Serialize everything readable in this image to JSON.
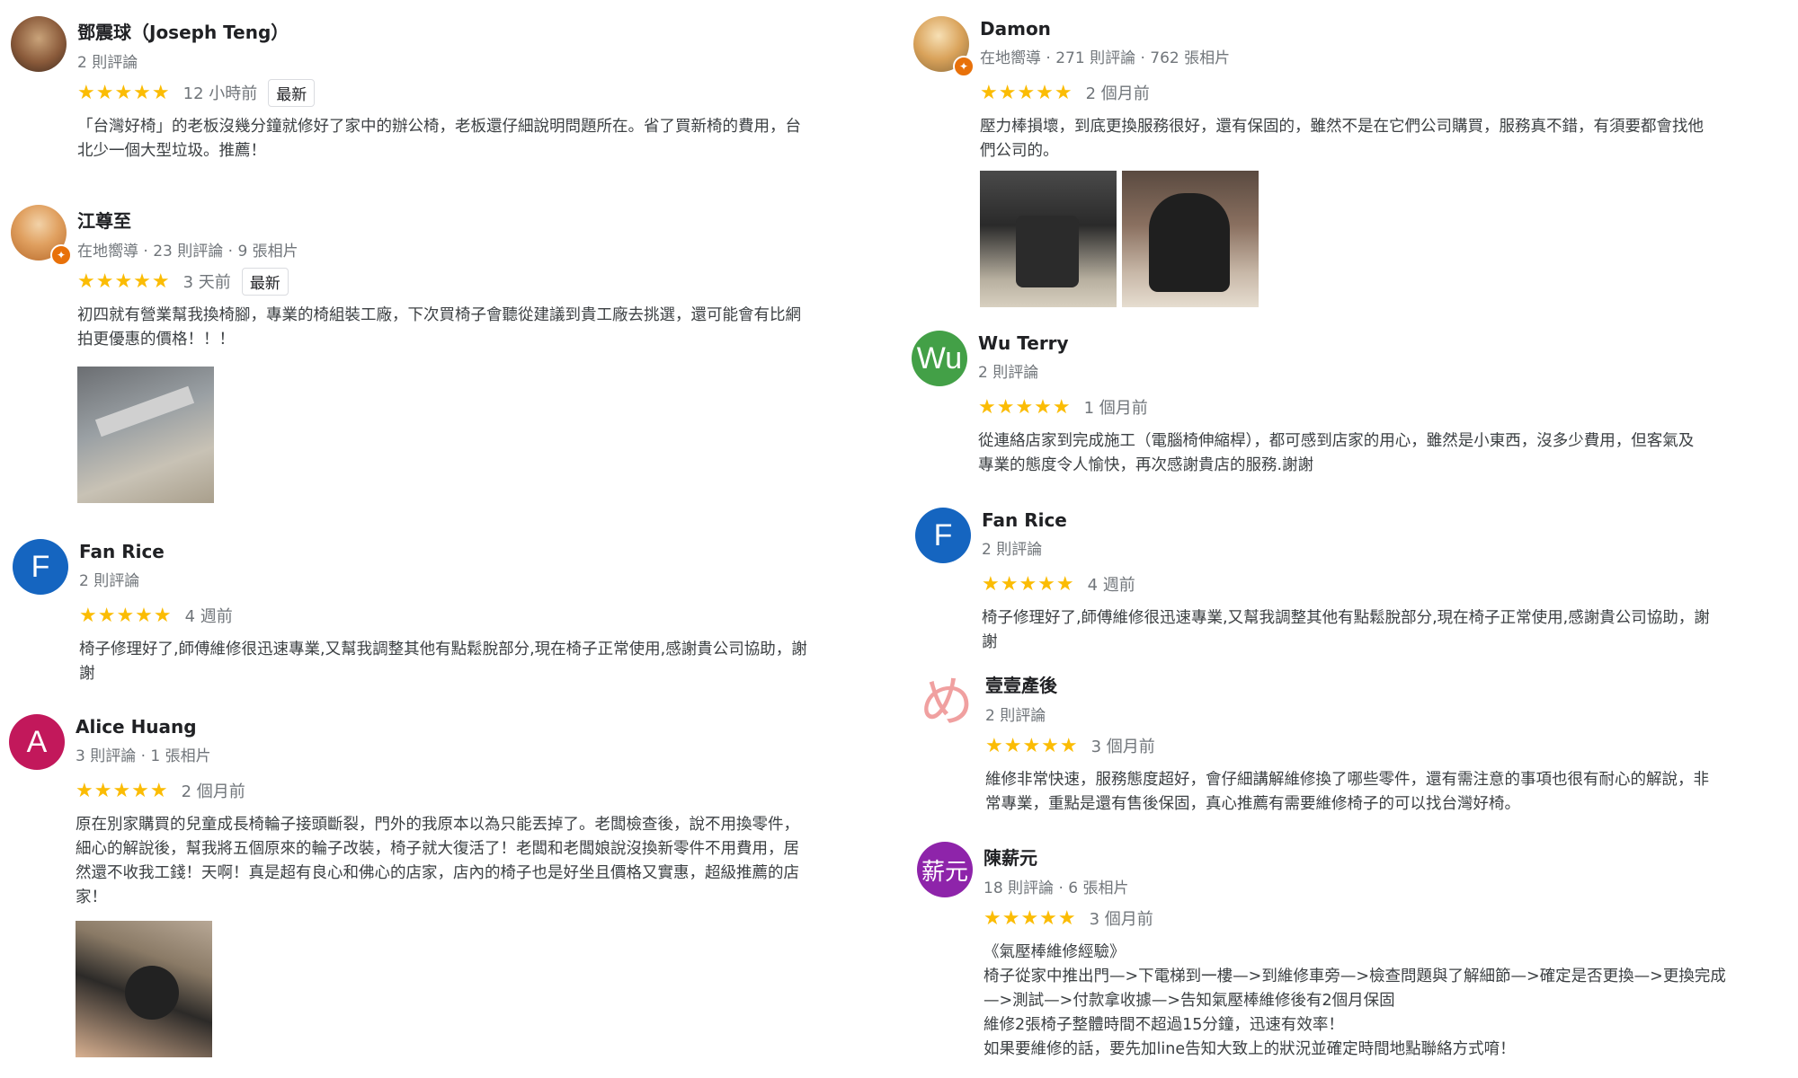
{
  "colors": {
    "star": "#fbbc04",
    "meta": "#70757a",
    "avatar_blue": "#1565c0",
    "avatar_pink": "#c2185b",
    "avatar_green": "#43a047",
    "avatar_purple": "#8e24aa"
  },
  "reviews": [
    {
      "name": "鄧震球（Joseph Teng）",
      "meta": "2 則評論",
      "stars": "★★★★★",
      "time": "12 小時前",
      "badge": "最新",
      "lines": [
        "「台灣好椅」的老板沒幾分鐘就修好了家中的辦公椅，老板還仔細說明問題所在。省了買新椅的費用，台",
        "北少一個大型垃圾。推薦！"
      ]
    },
    {
      "name": "江尊至",
      "meta": "在地嚮導 · 23 則評論 · 9 張相片",
      "stars": "★★★★★",
      "time": "3 天前",
      "badge": "最新",
      "lines": [
        "初四就有營業幫我換椅腳，專業的椅組裝工廠，下次買椅子會聽從建議到貴工廠去挑選，還可能會有比網",
        "拍更優惠的價格！！！"
      ]
    },
    {
      "name": "Fan Rice",
      "avatar_letter": "F",
      "meta": "2 則評論",
      "stars": "★★★★★",
      "time": "4 週前",
      "lines": [
        "椅子修理好了,師傅維修很迅速專業,又幫我調整其他有點鬆脫部分,現在椅子正常使用,感謝貴公司協助，謝",
        "謝"
      ]
    },
    {
      "name": "Alice Huang",
      "avatar_letter": "A",
      "meta": "3 則評論 · 1 張相片",
      "stars": "★★★★★",
      "time": "2 個月前",
      "lines": [
        "原在別家購買的兒童成長椅輪子接頭斷裂，門外的我原本以為只能丟掉了。老闆檢查後，說不用換零件，",
        "細心的解說後，幫我將五個原來的輪子改裝，椅子就大復活了！老闆和老闆娘說沒換新零件不用費用，居",
        "然還不收我工錢！天啊！真是超有良心和佛心的店家，店內的椅子也是好坐且價格又實惠，超級推薦的店",
        "家！"
      ]
    },
    {
      "name": "Damon",
      "meta": "在地嚮導 · 271 則評論 · 762 張相片",
      "stars": "★★★★★",
      "time": "2 個月前",
      "lines": [
        "壓力棒損壞，到底更換服務很好，還有保固的，雖然不是在它們公司購買，服務真不錯，有須要都會找他",
        "們公司的。"
      ]
    },
    {
      "name": "Wu Terry",
      "avatar_letter": "Wu",
      "meta": "2 則評論",
      "stars": "★★★★★",
      "time": "1 個月前",
      "lines": [
        "從連絡店家到完成施工（電腦椅伸縮桿），都可感到店家的用心，雖然是小東西，沒多少費用，但客氣及",
        "專業的態度令人愉快，再次感謝貴店的服務.謝謝"
      ]
    },
    {
      "name": "Fan Rice",
      "avatar_letter": "F",
      "meta": "2 則評論",
      "stars": "★★★★★",
      "time": "4 週前",
      "lines": [
        "椅子修理好了,師傅維修很迅速專業,又幫我調整其他有點鬆脫部分,現在椅子正常使用,感謝貴公司協助，謝",
        "謝"
      ]
    },
    {
      "name": "壹壹產後",
      "avatar_glyph": "め",
      "meta": "2 則評論",
      "stars": "★★★★★",
      "time": "3 個月前",
      "lines": [
        "維修非常快速，服務態度超好，會仔細講解維修換了哪些零件，還有需注意的事項也很有耐心的解說，非",
        "常專業，重點是還有售後保固，真心推薦有需要維修椅子的可以找台灣好椅。"
      ]
    },
    {
      "name": "陳薪元",
      "avatar_letter": "薪元",
      "meta": "18 則評論 · 6 張相片",
      "stars": "★★★★★",
      "time": "3 個月前",
      "lines": [
        "《氣壓棒維修經驗》",
        "椅子從家中推出門—>下電梯到一樓—>到維修車旁—>檢查問題與了解細節—>確定是否更換—>更換完成",
        "—>測試—>付款拿收據—>告知氣壓棒維修後有2個月保固",
        "維修2張椅子整體時間不超過15分鐘，迅速有效率！",
        "如果要維修的話，要先加line告知大致上的狀況並確定時間地點聯絡方式唷！"
      ]
    }
  ]
}
